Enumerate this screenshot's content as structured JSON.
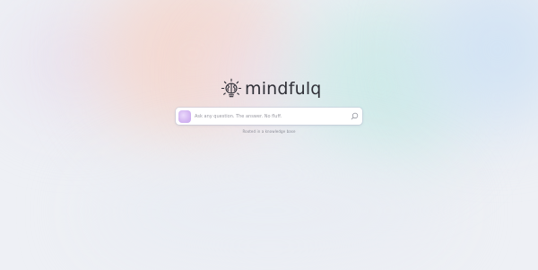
{
  "brand": {
    "name": "mindfulq",
    "logo_icon": "brain-lightbulb-icon"
  },
  "search": {
    "placeholder": "Ask any question. The answer. No fluff.",
    "value": "",
    "orb_icon": "gradient-orb-icon",
    "submit_icon": "search-icon"
  },
  "footnote": "Rooted in a knowledge base",
  "colors": {
    "text": "#2f2f37",
    "muted": "#8a8c96",
    "orb": "#d5b8f2",
    "background": "#eef0f5"
  }
}
